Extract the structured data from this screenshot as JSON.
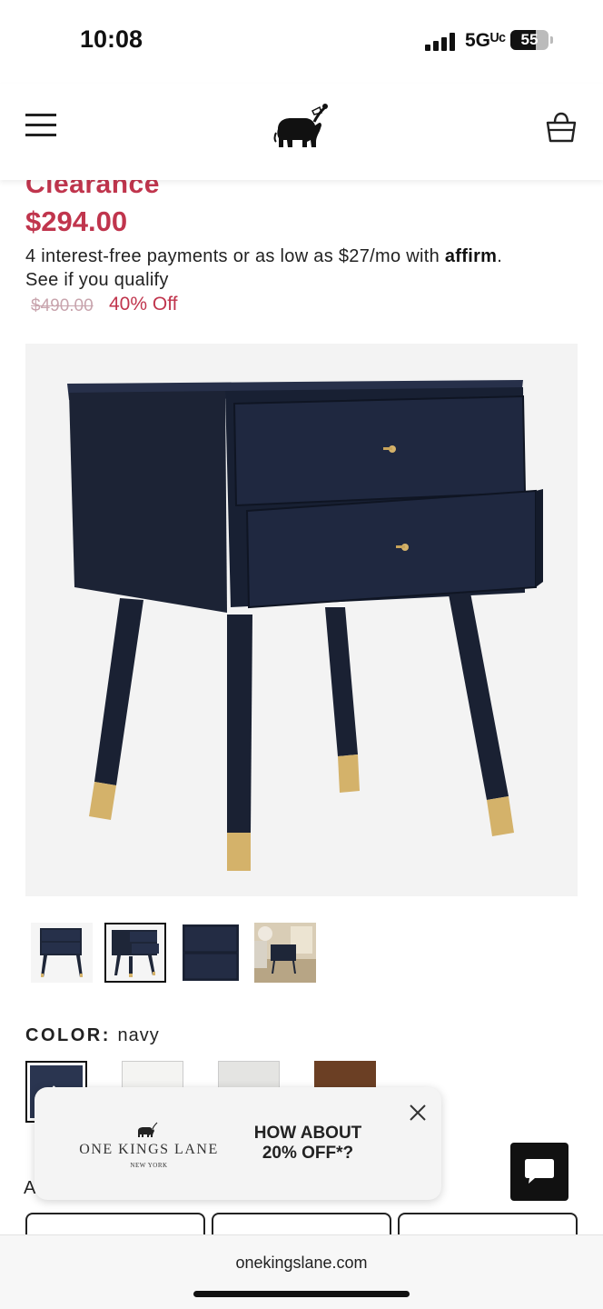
{
  "status_bar": {
    "time": "10:08",
    "network": "5Gᵁᶜ",
    "battery": "55"
  },
  "product": {
    "badge": "Clearance",
    "price": "$294.00",
    "affirm_text": "4 interest-free payments or as low as $27/mo with",
    "affirm_brand": "affirm",
    "affirm_end": ".",
    "qualify_link": "See if you qualify",
    "original_price": "$490.00",
    "discount": "40% Off",
    "color_label": "COLOR:",
    "color_value": "navy"
  },
  "swatches": [
    {
      "name": "navy",
      "color": "#2a3550",
      "selected": true
    },
    {
      "name": "white",
      "color": "#f4f4f2",
      "selected": false
    },
    {
      "name": "gray",
      "color": "#e4e4e2",
      "selected": false
    },
    {
      "name": "brown",
      "color": "#6b3f24",
      "selected": false
    }
  ],
  "section_label_partial": "A",
  "promo": {
    "brand": "ONE KINGS LANE",
    "brand_sub": "NEW YORK",
    "headline": "HOW ABOUT 20% OFF*?"
  },
  "browser": {
    "url": "onekingslane.com"
  },
  "colors": {
    "accent": "#c0354d",
    "furniture": "#1e2638",
    "brass": "#d4b26a"
  }
}
